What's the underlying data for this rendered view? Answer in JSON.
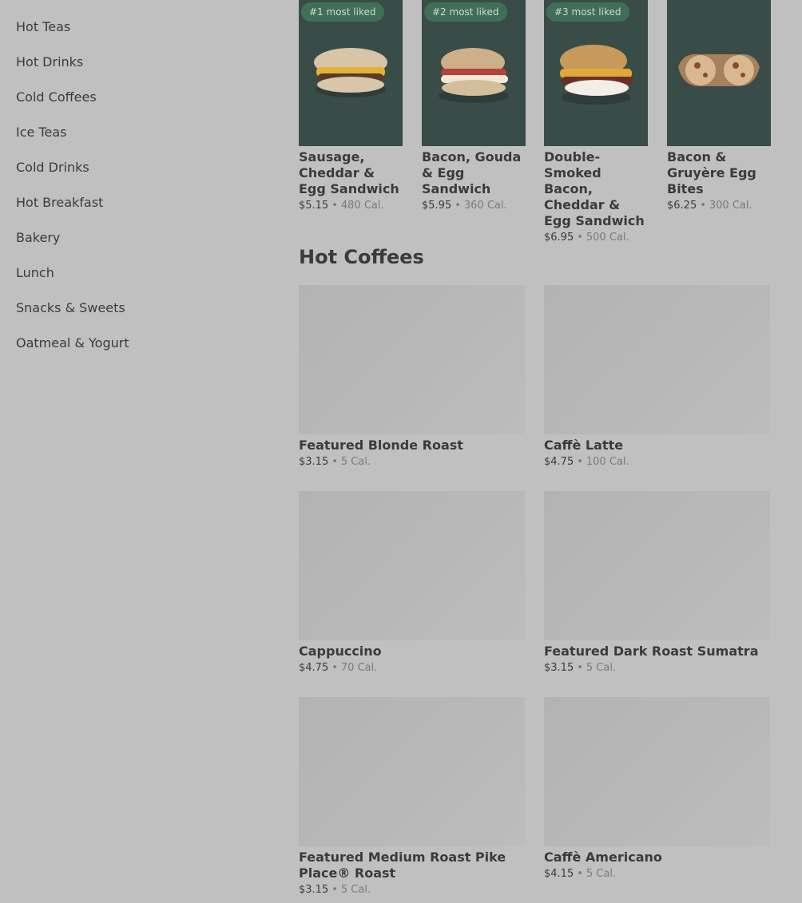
{
  "sidebar": {
    "items": [
      {
        "label": "Hot Teas"
      },
      {
        "label": "Hot Drinks"
      },
      {
        "label": "Cold Coffees"
      },
      {
        "label": "Ice Teas"
      },
      {
        "label": "Cold Drinks"
      },
      {
        "label": "Hot Breakfast"
      },
      {
        "label": "Bakery"
      },
      {
        "label": "Lunch"
      },
      {
        "label": "Snacks & Sweets"
      },
      {
        "label": "Oatmeal & Yogurt"
      }
    ]
  },
  "featured": [
    {
      "badge": "#1 most liked",
      "name": "Sausage, Cheddar & Egg Sandwich",
      "price": "$5.15",
      "calories": "480 Cal."
    },
    {
      "badge": "#2 most liked",
      "name": "Bacon, Gouda & Egg Sandwich",
      "price": "$5.95",
      "calories": "360 Cal."
    },
    {
      "badge": "#3 most liked",
      "name": "Double-Smoked Bacon, Cheddar & Egg Sandwich",
      "price": "$6.95",
      "calories": "500 Cal."
    },
    {
      "badge": "",
      "name": "Bacon & Gruyère Egg Bites",
      "price": "$6.25",
      "calories": "300 Cal."
    }
  ],
  "hot_coffees": {
    "title": "Hot Coffees",
    "items": [
      {
        "name": "Featured Blonde Roast",
        "price": "$3.15",
        "calories": "5 Cal."
      },
      {
        "name": "Caffè Latte",
        "price": "$4.75",
        "calories": "100 Cal."
      },
      {
        "name": "Cappuccino",
        "price": "$4.75",
        "calories": "70 Cal."
      },
      {
        "name": "Featured Dark Roast Sumatra",
        "price": "$3.15",
        "calories": "5 Cal."
      },
      {
        "name": "Featured Medium Roast Pike Place® Roast",
        "price": "$3.15",
        "calories": "5 Cal."
      },
      {
        "name": "Caffè Americano",
        "price": "$4.15",
        "calories": "5 Cal."
      }
    ]
  },
  "separator": "•"
}
